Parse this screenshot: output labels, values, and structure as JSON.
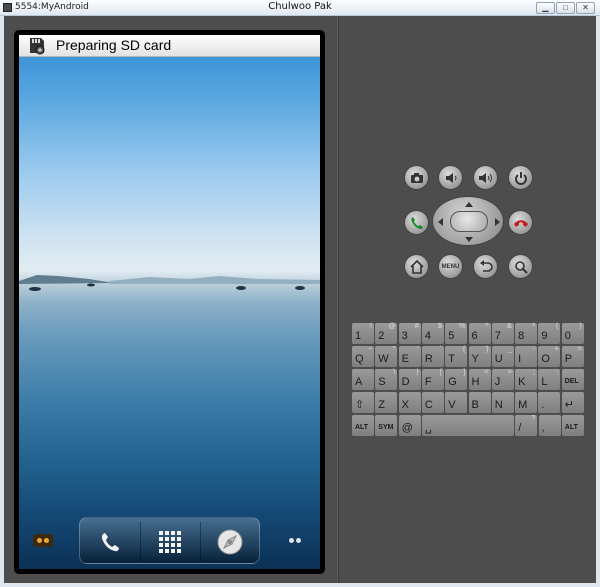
{
  "window": {
    "left_title": "5554:MyAndroid",
    "center_title": "Chulwoo Pak",
    "buttons": [
      "minimize",
      "maximize",
      "close"
    ]
  },
  "phone": {
    "status_text": "Preparing SD card",
    "status_icon": "sd-card-icon",
    "dock": [
      "phone-icon",
      "app-drawer-icon",
      "browser-icon"
    ]
  },
  "controls": {
    "row1": [
      "camera-icon",
      "volume-down-icon",
      "volume-up-icon",
      "power-icon"
    ],
    "row2": [
      "call-icon",
      "dpad",
      "end-call-icon"
    ],
    "row3": [
      "home-icon",
      "menu-button",
      "back-icon",
      "search-icon"
    ],
    "menu_label": "MENU"
  },
  "keyboard": {
    "rows": [
      [
        {
          "main": "1",
          "shift": "!"
        },
        {
          "main": "2",
          "shift": "@"
        },
        {
          "main": "3",
          "shift": "#"
        },
        {
          "main": "4",
          "shift": "$"
        },
        {
          "main": "5",
          "shift": "%"
        },
        {
          "main": "6",
          "shift": "^"
        },
        {
          "main": "7",
          "shift": "&"
        },
        {
          "main": "8",
          "shift": "*"
        },
        {
          "main": "9",
          "shift": "("
        },
        {
          "main": "0",
          "shift": ")"
        }
      ],
      [
        {
          "main": "Q",
          "shift": "~"
        },
        {
          "main": "W",
          "shift": "\""
        },
        {
          "main": "E",
          "shift": "'"
        },
        {
          "main": "R",
          "shift": "`"
        },
        {
          "main": "T",
          "shift": "{"
        },
        {
          "main": "Y",
          "shift": "}"
        },
        {
          "main": "U",
          "shift": "_"
        },
        {
          "main": "I",
          "shift": "-"
        },
        {
          "main": "O",
          "shift": "+"
        },
        {
          "main": "P",
          "shift": "="
        }
      ],
      [
        {
          "main": "A",
          "shift": ""
        },
        {
          "main": "S",
          "shift": "\\"
        },
        {
          "main": "D",
          "shift": "|"
        },
        {
          "main": "F",
          "shift": "["
        },
        {
          "main": "G",
          "shift": "]"
        },
        {
          "main": "H",
          "shift": "<"
        },
        {
          "main": "J",
          "shift": ">"
        },
        {
          "main": "K",
          "shift": ";"
        },
        {
          "main": "L",
          "shift": ":"
        },
        {
          "main": "DEL",
          "shift": ""
        }
      ],
      [
        {
          "main": "⇧",
          "shift": ""
        },
        {
          "main": "Z",
          "shift": ""
        },
        {
          "main": "X",
          "shift": ""
        },
        {
          "main": "C",
          "shift": ""
        },
        {
          "main": "V",
          "shift": ""
        },
        {
          "main": "B",
          "shift": ""
        },
        {
          "main": "N",
          "shift": ""
        },
        {
          "main": "M",
          "shift": ""
        },
        {
          "main": ".",
          "shift": ""
        },
        {
          "main": "↵",
          "shift": ""
        }
      ],
      [
        {
          "main": "ALT",
          "shift": ""
        },
        {
          "main": "SYM",
          "shift": ""
        },
        {
          "main": "@",
          "shift": ""
        },
        {
          "main": "␣",
          "shift": ""
        },
        {
          "main": "/",
          "shift": "?"
        },
        {
          "main": ",",
          "shift": ""
        },
        {
          "main": "ALT",
          "shift": ""
        }
      ]
    ]
  }
}
